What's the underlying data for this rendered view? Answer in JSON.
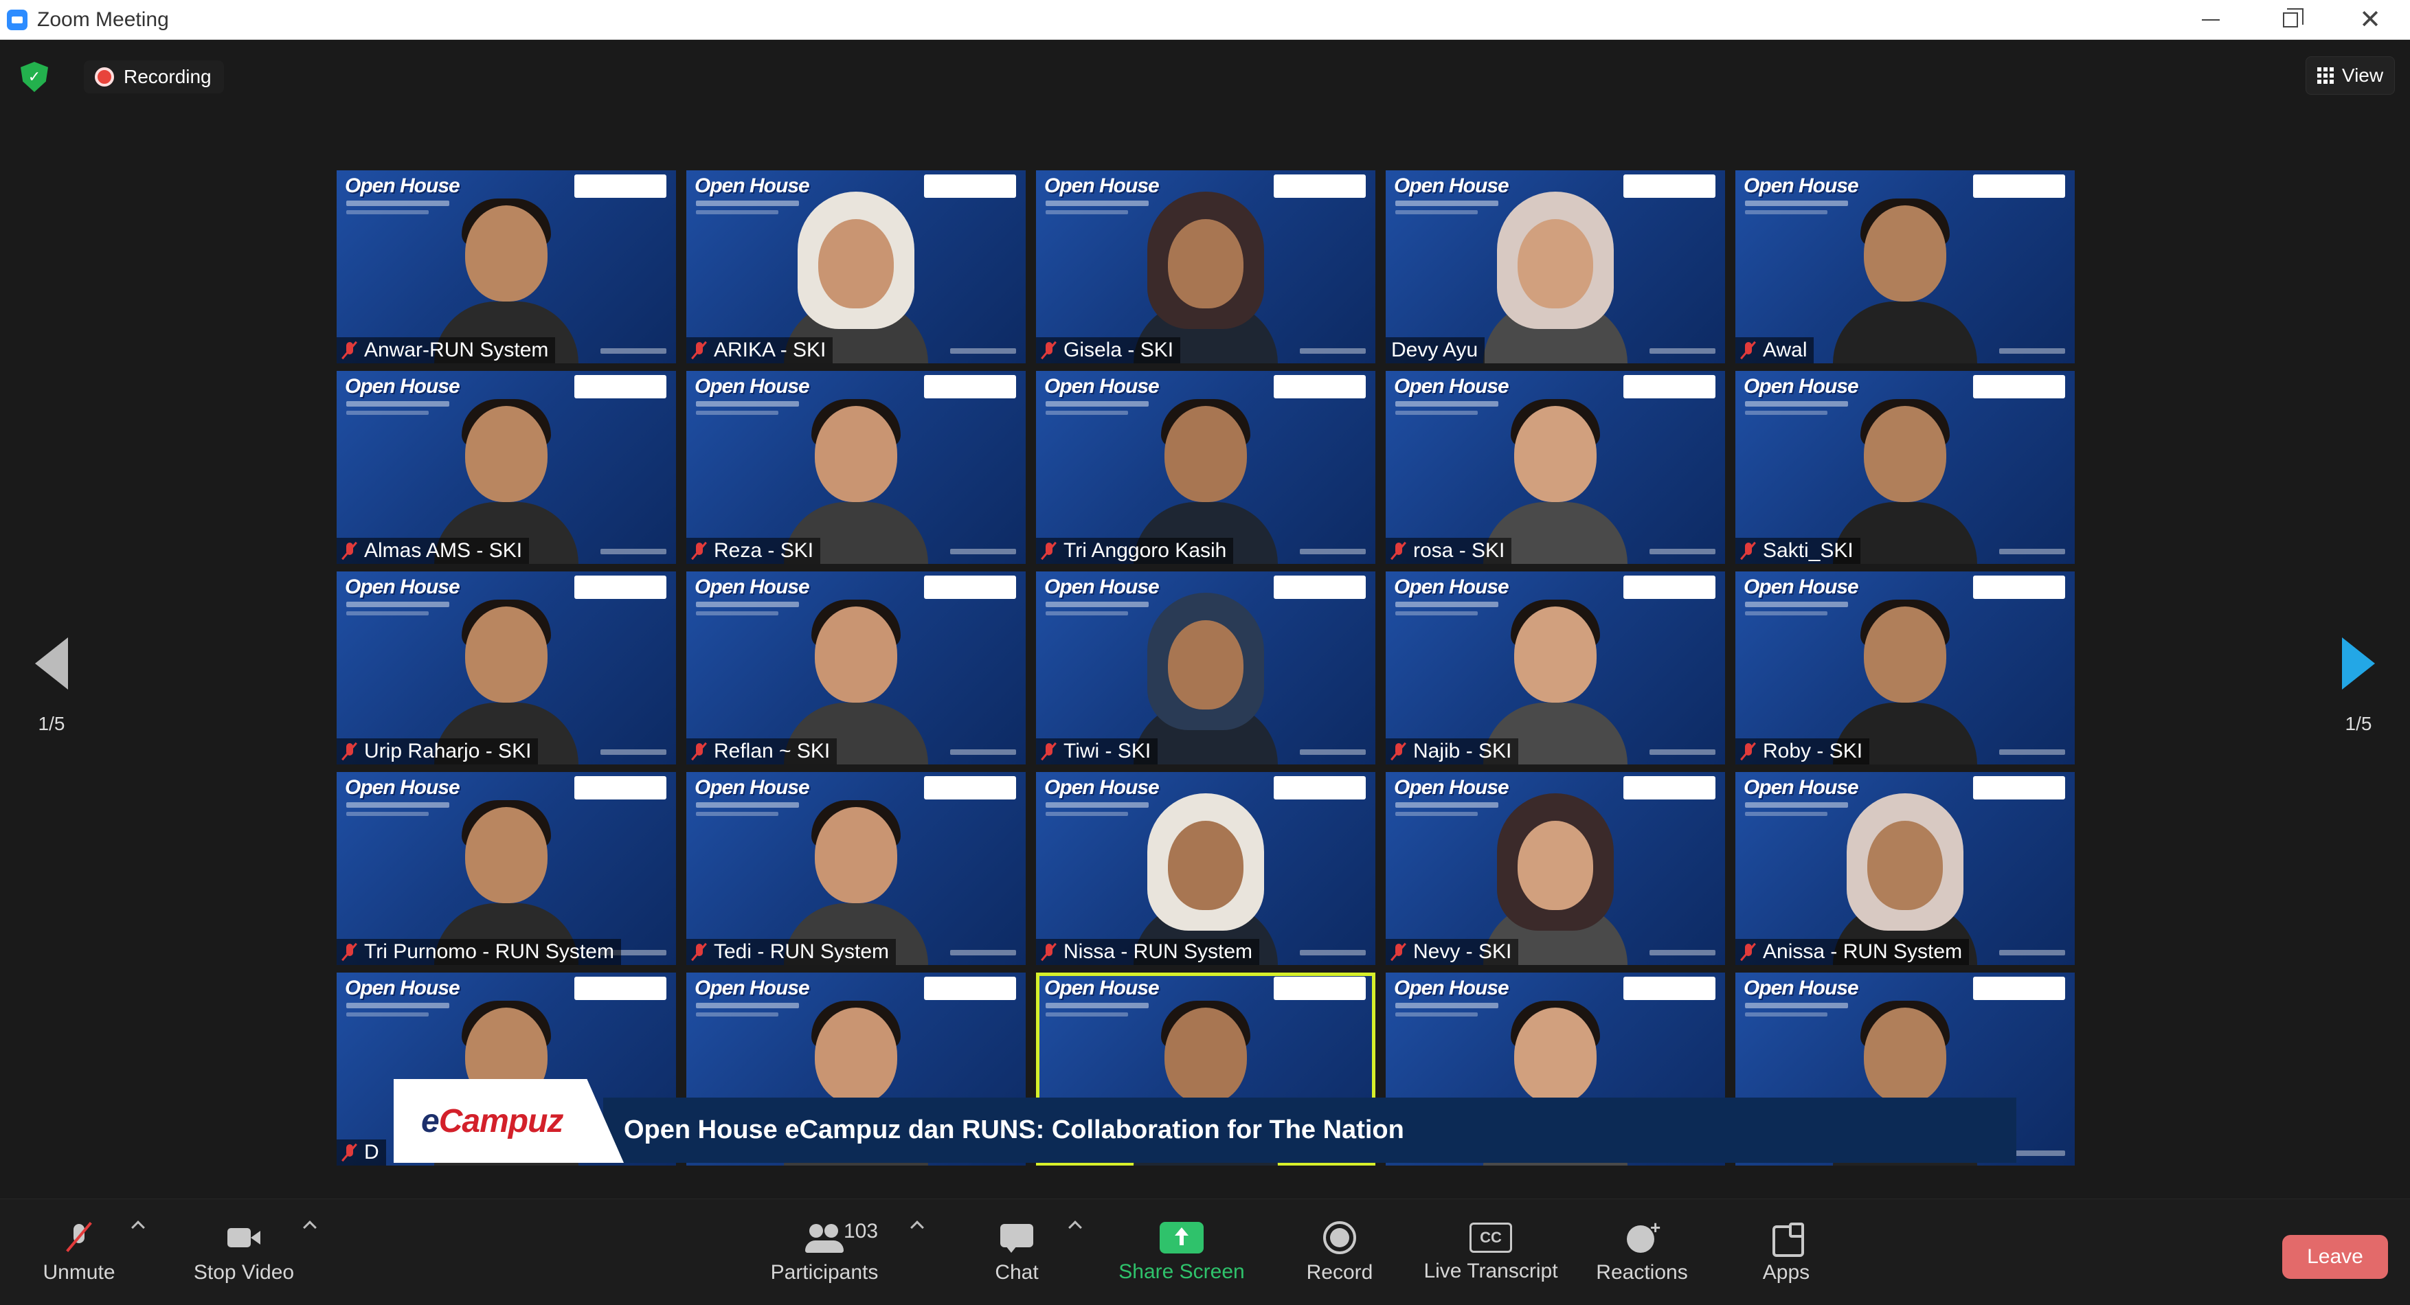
{
  "window": {
    "title": "Zoom Meeting"
  },
  "header": {
    "recording_label": "Recording",
    "view_label": "View"
  },
  "pagination": {
    "left": "1/5",
    "right": "1/5"
  },
  "participants": [
    {
      "name": "Anwar-RUN System",
      "muted": true
    },
    {
      "name": "ARIKA - SKI",
      "muted": true,
      "hijab": true
    },
    {
      "name": "Gisela - SKI",
      "muted": true,
      "hijab": true
    },
    {
      "name": "Devy Ayu",
      "muted": false,
      "hijab": true
    },
    {
      "name": "Awal",
      "muted": true
    },
    {
      "name": "Almas AMS - SKI",
      "muted": true
    },
    {
      "name": "Reza - SKI",
      "muted": true
    },
    {
      "name": "Tri Anggoro Kasih",
      "muted": true
    },
    {
      "name": "rosa - SKI",
      "muted": true
    },
    {
      "name": "Sakti_SKI",
      "muted": true
    },
    {
      "name": "Urip Raharjo - SKI",
      "muted": true
    },
    {
      "name": "Reflan ~ SKI",
      "muted": true
    },
    {
      "name": "Tiwi - SKI",
      "muted": true,
      "hijab": true
    },
    {
      "name": "Najib - SKI",
      "muted": true
    },
    {
      "name": "Roby - SKI",
      "muted": true
    },
    {
      "name": "Tri Purnomo - RUN System",
      "muted": true
    },
    {
      "name": "Tedi  - RUN System",
      "muted": true
    },
    {
      "name": "Nissa - RUN System",
      "muted": true,
      "hijab": true
    },
    {
      "name": "Nevy - SKI",
      "muted": true,
      "hijab": true
    },
    {
      "name": "Anissa - RUN System",
      "muted": true,
      "hijab": true
    },
    {
      "name": "D",
      "muted": true
    },
    {
      "name": "",
      "muted": false
    },
    {
      "name": "",
      "muted": false,
      "active": true
    },
    {
      "name": "",
      "muted": false
    },
    {
      "name": "",
      "muted": false
    }
  ],
  "virtual_background": {
    "title": "Open House"
  },
  "banner": {
    "logo_prefix": "e",
    "logo_rest": "Campuz",
    "text": "Open House eCampuz dan RUNS: Collaboration for The Nation"
  },
  "toolbar": {
    "unmute": "Unmute",
    "stop_video": "Stop Video",
    "participants": "Participants",
    "participant_count": "103",
    "chat": "Chat",
    "share_screen": "Share Screen",
    "record": "Record",
    "live_transcript": "Live Transcript",
    "cc_icon_text": "CC",
    "reactions": "Reactions",
    "apps": "Apps",
    "leave": "Leave"
  },
  "colors": {
    "share_green": "#2fc26b",
    "leave_red": "#e36a6a",
    "active_speaker": "#d7f02a",
    "next_arrow": "#23a7e6"
  }
}
